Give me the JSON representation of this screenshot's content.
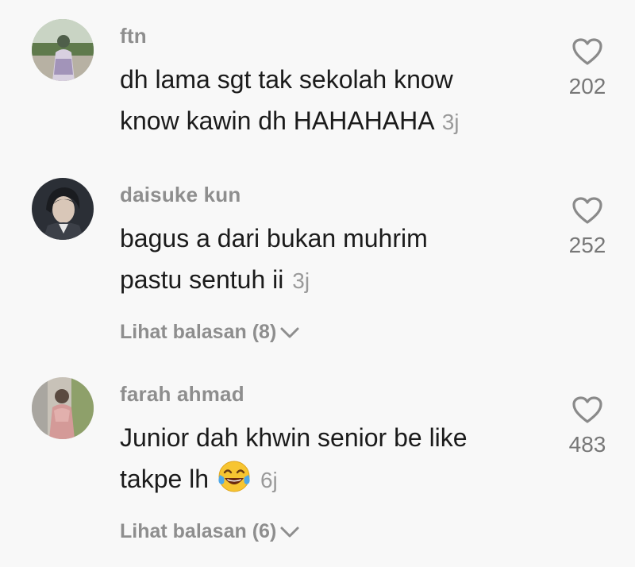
{
  "comments": [
    {
      "username": "ftn",
      "text_line1": "dh lama sgt tak sekolah know",
      "text_line2": "know kawin dh HAHAHAHA",
      "time": "3j",
      "likes": "202",
      "avatar_icon": "user-photo-avatar"
    },
    {
      "username": "daisuke kun",
      "text_line1": "bagus a dari bukan muhrim",
      "text_line2": "pastu sentuh ii",
      "time": "3j",
      "likes": "252",
      "replies_label": "Lihat balasan (8)",
      "avatar_icon": "anime-character-avatar"
    },
    {
      "username": "farah ahmad",
      "text_line1": "Junior dah khwin senior be like",
      "text_line2": "takpe lh",
      "emoji": "face-with-tears-of-joy",
      "time": "6j",
      "likes": "483",
      "replies_label": "Lihat balasan (6)",
      "avatar_icon": "user-photo-avatar"
    }
  ],
  "colors": {
    "background": "#f8f8f8",
    "username": "#8e8e8e",
    "text": "#1b1b1b",
    "meta": "#9a9a9a"
  }
}
